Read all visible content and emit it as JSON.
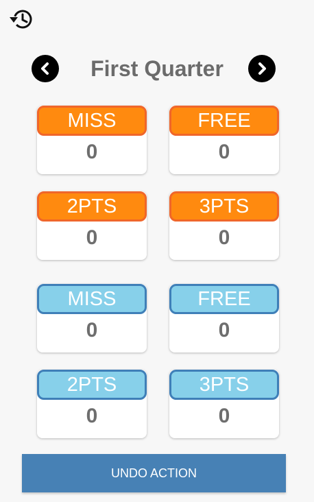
{
  "header": {
    "history_icon": "history-icon"
  },
  "quarter": {
    "title": "First Quarter",
    "prev_icon": "chevron-left-icon",
    "next_icon": "chevron-right-icon"
  },
  "team_home": {
    "color": "#ff8a0f",
    "border_color": "#f0662a",
    "stats": [
      {
        "label": "MISS",
        "value": "0"
      },
      {
        "label": "FREE",
        "value": "0"
      },
      {
        "label": "2PTS",
        "value": "0"
      },
      {
        "label": "3PTS",
        "value": "0"
      }
    ]
  },
  "team_away": {
    "color": "#87d0ea",
    "border_color": "#3f7fb8",
    "stats": [
      {
        "label": "MISS",
        "value": "0"
      },
      {
        "label": "FREE",
        "value": "0"
      },
      {
        "label": "2PTS",
        "value": "0"
      },
      {
        "label": "3PTS",
        "value": "0"
      }
    ]
  },
  "undo": {
    "label": "UNDO ACTION",
    "color": "#4781b5"
  }
}
